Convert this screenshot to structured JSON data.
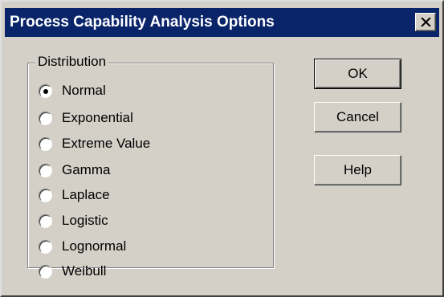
{
  "window": {
    "title": "Process Capability Analysis Options"
  },
  "close_button": {
    "icon": "close-icon"
  },
  "distribution": {
    "group_label": "Distribution",
    "selected": "Normal",
    "options": [
      {
        "label": "Normal",
        "checked": true
      },
      {
        "label": "Exponential",
        "checked": false
      },
      {
        "label": "Extreme Value",
        "checked": false
      },
      {
        "label": "Gamma",
        "checked": false
      },
      {
        "label": "Laplace",
        "checked": false
      },
      {
        "label": "Logistic",
        "checked": false
      },
      {
        "label": "Lognormal",
        "checked": false
      },
      {
        "label": "Weibull",
        "checked": false
      }
    ]
  },
  "buttons": {
    "ok_label": "OK",
    "cancel_label": "Cancel",
    "help_label": "Help"
  },
  "colors": {
    "titlebar": "#0a246a",
    "face": "#d4d0c8"
  }
}
